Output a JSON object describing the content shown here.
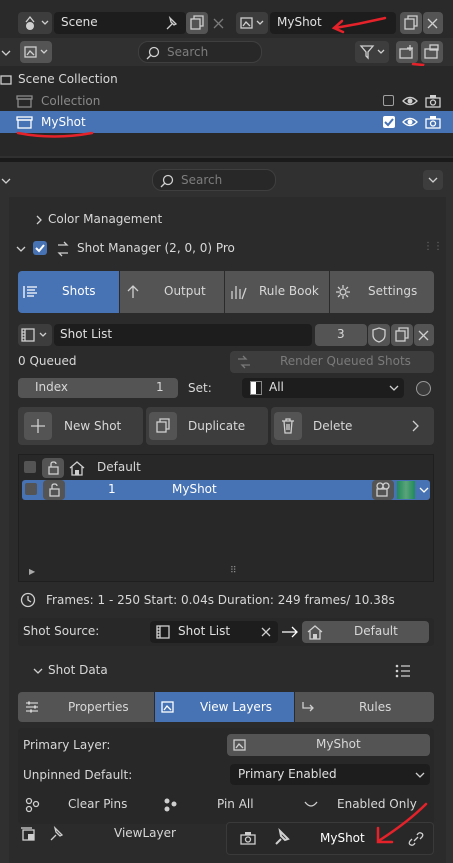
{
  "top": {
    "scene_label": "Scene",
    "layer_label": "MyShot"
  },
  "outliner": {
    "search_placeholder": "Search",
    "scene_collection": "Scene Collection",
    "collection": "Collection",
    "myshot": "MyShot"
  },
  "props": {
    "search_placeholder": "Search",
    "color_management": "Color Management"
  },
  "panel": {
    "title": "Shot Manager (2, 0, 0) Pro",
    "tabs": [
      "Shots",
      "Output",
      "Rule Book",
      "Settings"
    ],
    "shot_list_label": "Shot List",
    "shot_list_count": "3",
    "queued": "0 Queued",
    "render_queued": "Render Queued Shots",
    "index_label": "Index",
    "index_value": "1",
    "set_label": "Set:",
    "set_value": "All",
    "new_shot": "New Shot",
    "duplicate": "Duplicate",
    "delete": "Delete",
    "list_group": "Default",
    "shot_index": "1",
    "shot_name": "MyShot",
    "frames_info": "Frames: 1 - 250   Start: 0.04s  Duration: 249 frames/ 10.38s",
    "shot_source_label": "Shot Source:",
    "shot_source_value": "Shot List",
    "shot_source_target": "Default",
    "shot_data": "Shot Data",
    "sub_tabs": [
      "Properties",
      "View Layers",
      "Rules"
    ],
    "primary_layer_label": "Primary Layer:",
    "primary_layer_value": "MyShot",
    "unpinned_label": "Unpinned Default:",
    "unpinned_value": "Primary Enabled",
    "clear_pins": "Clear Pins",
    "pin_all": "Pin All",
    "enabled_only": "Enabled Only",
    "view_layer": "ViewLayer",
    "bottom_myshot": "MyShot"
  },
  "colors": {
    "accent_blue": "#4772b3",
    "annotation_red": "#e5222a"
  }
}
